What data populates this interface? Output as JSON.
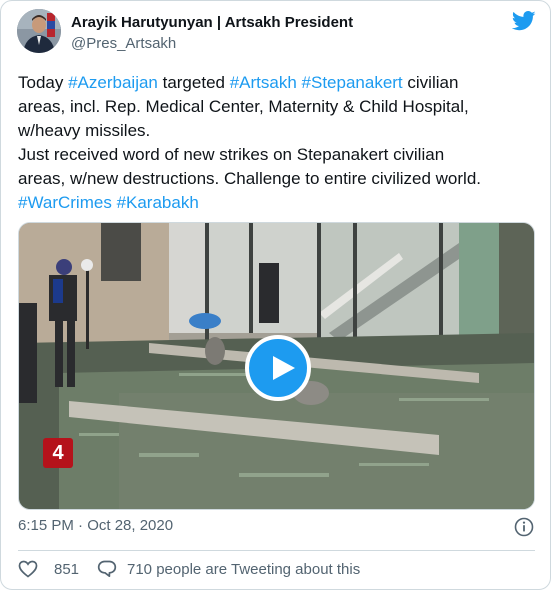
{
  "author": {
    "name": "Arayik Harutyunyan | Artsakh President",
    "handle": "@Pres_Artsakh"
  },
  "tweet": {
    "lines": [
      [
        {
          "t": "Today ",
          "h": false
        },
        {
          "t": "#Azerbaijan",
          "h": true
        },
        {
          "t": " targeted ",
          "h": false
        },
        {
          "t": "#Artsakh",
          "h": true
        },
        {
          "t": " ",
          "h": false
        },
        {
          "t": "#Stepanakert",
          "h": true
        },
        {
          "t": " civilian",
          "h": false
        }
      ],
      [
        {
          "t": "areas, incl. Rep. Medical Center, Maternity & Child Hospital,",
          "h": false
        }
      ],
      [
        {
          "t": "w/heavy missiles.",
          "h": false
        }
      ],
      [
        {
          "t": "Just received word of new strikes on Stepanakert civilian",
          "h": false
        }
      ],
      [
        {
          "t": "areas, w/new destructions. Challenge to entire civilized world.",
          "h": false
        }
      ],
      [
        {
          "t": "#WarCrimes",
          "h": true
        },
        {
          "t": " ",
          "h": false
        },
        {
          "t": "#Karabakh",
          "h": true
        }
      ]
    ]
  },
  "media": {
    "type": "video",
    "channel_logo": "4"
  },
  "timestamp": "6:15 PM · Oct 28, 2020",
  "engagement": {
    "likes": "851",
    "talking": "710 people are Tweeting about this"
  },
  "colors": {
    "accent": "#1d9bf0",
    "text": "#0f1419",
    "secondary": "#536471",
    "border": "#cfd9de"
  },
  "icons": {
    "brand": "twitter-bird-icon",
    "info": "info-icon",
    "like": "heart-icon",
    "reply": "speech-bubble-icon",
    "play": "play-icon"
  }
}
